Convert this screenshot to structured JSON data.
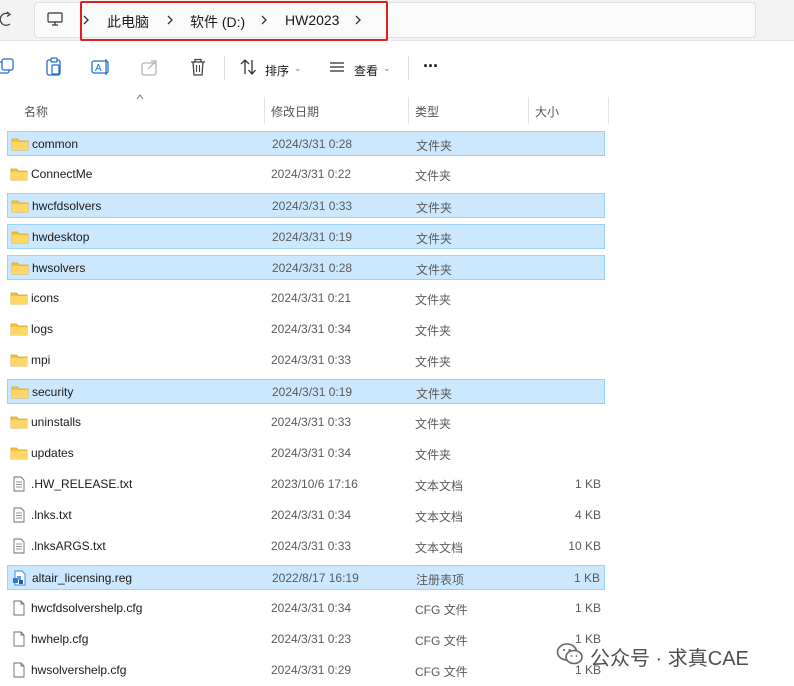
{
  "breadcrumb": {
    "items": [
      "此电脑",
      "软件 (D:)",
      "HW2023"
    ]
  },
  "toolbar": {
    "sort_label": "排序",
    "view_label": "查看",
    "more_label": "···"
  },
  "columns": {
    "name": "名称",
    "date": "修改日期",
    "type": "类型",
    "size": "大小"
  },
  "files": [
    {
      "name": "common",
      "date": "2024/3/31 0:28",
      "type": "文件夹",
      "size": "",
      "icon": "folder-icon",
      "selected": true
    },
    {
      "name": "ConnectMe",
      "date": "2024/3/31 0:22",
      "type": "文件夹",
      "size": "",
      "icon": "folder-icon",
      "selected": false
    },
    {
      "name": "hwcfdsolvers",
      "date": "2024/3/31 0:33",
      "type": "文件夹",
      "size": "",
      "icon": "folder-icon",
      "selected": true
    },
    {
      "name": "hwdesktop",
      "date": "2024/3/31 0:19",
      "type": "文件夹",
      "size": "",
      "icon": "folder-icon",
      "selected": true
    },
    {
      "name": "hwsolvers",
      "date": "2024/3/31 0:28",
      "type": "文件夹",
      "size": "",
      "icon": "folder-icon",
      "selected": true
    },
    {
      "name": "icons",
      "date": "2024/3/31 0:21",
      "type": "文件夹",
      "size": "",
      "icon": "folder-icon",
      "selected": false
    },
    {
      "name": "logs",
      "date": "2024/3/31 0:34",
      "type": "文件夹",
      "size": "",
      "icon": "folder-icon",
      "selected": false
    },
    {
      "name": "mpi",
      "date": "2024/3/31 0:33",
      "type": "文件夹",
      "size": "",
      "icon": "folder-icon",
      "selected": false
    },
    {
      "name": "security",
      "date": "2024/3/31 0:19",
      "type": "文件夹",
      "size": "",
      "icon": "folder-icon",
      "selected": true
    },
    {
      "name": "uninstalls",
      "date": "2024/3/31 0:33",
      "type": "文件夹",
      "size": "",
      "icon": "folder-icon",
      "selected": false
    },
    {
      "name": "updates",
      "date": "2024/3/31 0:34",
      "type": "文件夹",
      "size": "",
      "icon": "folder-icon",
      "selected": false
    },
    {
      "name": ".HW_RELEASE.txt",
      "date": "2023/10/6 17:16",
      "type": "文本文档",
      "size": "1 KB",
      "icon": "text-file-icon",
      "selected": false
    },
    {
      "name": ".lnks.txt",
      "date": "2024/3/31 0:34",
      "type": "文本文档",
      "size": "4 KB",
      "icon": "text-file-icon",
      "selected": false
    },
    {
      "name": ".lnksARGS.txt",
      "date": "2024/3/31 0:33",
      "type": "文本文档",
      "size": "10 KB",
      "icon": "text-file-icon",
      "selected": false
    },
    {
      "name": "altair_licensing.reg",
      "date": "2022/8/17 16:19",
      "type": "注册表项",
      "size": "1 KB",
      "icon": "registry-file-icon",
      "selected": true
    },
    {
      "name": "hwcfdsolvershelp.cfg",
      "date": "2024/3/31 0:34",
      "type": "CFG 文件",
      "size": "1 KB",
      "icon": "file-icon",
      "selected": false
    },
    {
      "name": "hwhelp.cfg",
      "date": "2024/3/31 0:23",
      "type": "CFG 文件",
      "size": "1 KB",
      "icon": "file-icon",
      "selected": false
    },
    {
      "name": "hwsolvershelp.cfg",
      "date": "2024/3/31 0:29",
      "type": "CFG 文件",
      "size": "1 KB",
      "icon": "file-icon",
      "selected": false
    }
  ],
  "watermark": {
    "text": "公众号 · 求真CAE"
  },
  "colors": {
    "selection_fill": "#cce8ff",
    "selection_border": "#99d1ff",
    "highlight_box": "#e02020",
    "folder": "#f8c33c"
  }
}
